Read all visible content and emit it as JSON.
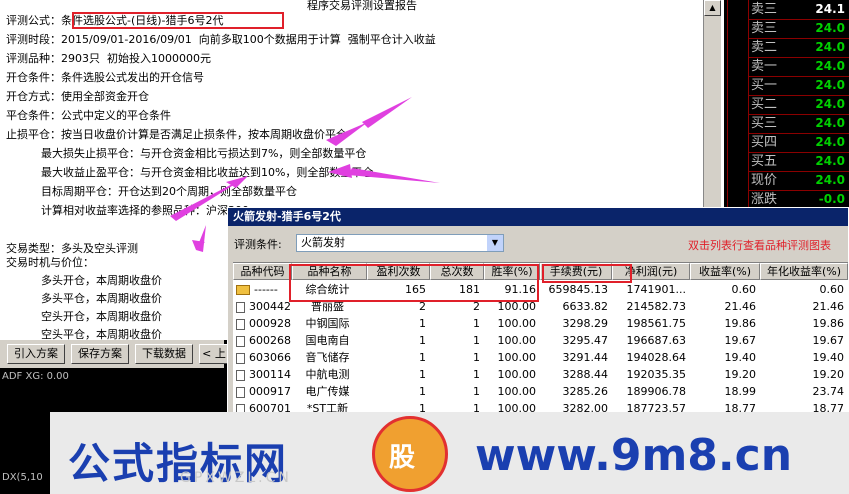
{
  "report": {
    "title": "程序交易评测设置报告",
    "lines": [
      "评测公式：条件选股公式-(日线)-猎手6号2代",
      "评测时段：2015/09/01-2016/09/01  向前多取100个数据用于计算  强制平仓计入收益",
      "评测品种：2903只  初始投入1000000元",
      "开仓条件：条件选股公式发出的开仓信号",
      "开仓方式：使用全部资金开仓",
      "平仓条件：公式中定义的平仓条件",
      "止损平仓：按当日收盘价计算是否满足止损条件，按本周期收盘价平仓",
      "          最大损失止损平仓：与开仓资金相比亏损达到7%，则全部数量平仓",
      "          最大收益止盈平仓：与开仓资金相比收益达到10%，则全部数量平仓",
      "          目标周期平仓：开仓达到20个周期，则全部数量平仓",
      "          计算相对收益率选择的参照品种：沪深300",
      "",
      "交易类型：多头及空头评测",
      "交易时机与价位：",
      "          多头开仓，本周期收盘价",
      "          多头平仓，本周期收盘价",
      "          空头开仓，本周期收盘价",
      "          空头平仓，本周期收盘价"
    ]
  },
  "buttons": {
    "import": "引入方案",
    "save": "保存方案",
    "download": "下载数据",
    "prev": "< 上"
  },
  "left_panel": {
    "adf": "ADF  XG: 0.00",
    "dx": "DX(5,10"
  },
  "quotes": {
    "items": [
      {
        "label": "卖三",
        "value": "24.1"
      },
      {
        "label": "卖三",
        "value": "24.0"
      },
      {
        "label": "卖二",
        "value": "24.0"
      },
      {
        "label": "卖一",
        "value": "24.0"
      },
      {
        "label": "买一",
        "value": "24.0"
      },
      {
        "label": "买二",
        "value": "24.0"
      },
      {
        "label": "买三",
        "value": "24.0"
      },
      {
        "label": "买四",
        "value": "24.0"
      },
      {
        "label": "买五",
        "value": "24.0"
      },
      {
        "label": "现价",
        "value": "24.0"
      },
      {
        "label": "涨跌",
        "value": "-0.0"
      }
    ]
  },
  "popup": {
    "title": "火箭发射-猎手6号2代",
    "condition_label": "评测条件:",
    "condition_value": "火箭发射",
    "hint": "双击列表行查看品种评测图表",
    "columns": [
      "品种代码",
      "品种名称",
      "盈利次数",
      "总次数",
      "胜率(%)",
      "手续费(元)",
      "净利润(元)",
      "收益率(%)",
      "年化收益率(%)"
    ],
    "rows": [
      {
        "code": "------",
        "name": "综合统计",
        "wins": "165",
        "total": "181",
        "rate": "91.16",
        "fee": "659845.13",
        "profit": "1741901...",
        "ret": "0.60",
        "annual": "0.60",
        "summary": true
      },
      {
        "code": "300442",
        "name": "普丽盛",
        "wins": "2",
        "total": "2",
        "rate": "100.00",
        "fee": "6633.82",
        "profit": "214582.73",
        "ret": "21.46",
        "annual": "21.46"
      },
      {
        "code": "000928",
        "name": "中钢国际",
        "wins": "1",
        "total": "1",
        "rate": "100.00",
        "fee": "3298.29",
        "profit": "198561.75",
        "ret": "19.86",
        "annual": "19.86"
      },
      {
        "code": "600268",
        "name": "国电南自",
        "wins": "1",
        "total": "1",
        "rate": "100.00",
        "fee": "3295.47",
        "profit": "196687.63",
        "ret": "19.67",
        "annual": "19.67"
      },
      {
        "code": "603066",
        "name": "音飞储存",
        "wins": "1",
        "total": "1",
        "rate": "100.00",
        "fee": "3291.44",
        "profit": "194028.64",
        "ret": "19.40",
        "annual": "19.40"
      },
      {
        "code": "300114",
        "name": "中航电测",
        "wins": "1",
        "total": "1",
        "rate": "100.00",
        "fee": "3288.44",
        "profit": "192035.35",
        "ret": "19.20",
        "annual": "19.20"
      },
      {
        "code": "000917",
        "name": "电广传媒",
        "wins": "1",
        "total": "1",
        "rate": "100.00",
        "fee": "3285.26",
        "profit": "189906.78",
        "ret": "18.99",
        "annual": "23.74"
      },
      {
        "code": "600701",
        "name": "*ST工新",
        "wins": "1",
        "total": "1",
        "rate": "100.00",
        "fee": "3282.00",
        "profit": "187723.57",
        "ret": "18.77",
        "annual": "18.77"
      }
    ]
  },
  "banner": {
    "brand": "公式指标网",
    "logo": "股",
    "site": "www.9m8.cn",
    "faint": "GPXWZL.CN"
  },
  "colors": {
    "highlight_red": "#e0202a",
    "title_bar": "#0a246a",
    "quote_green": "#00d000",
    "brand_blue": "#1a3fb0"
  }
}
